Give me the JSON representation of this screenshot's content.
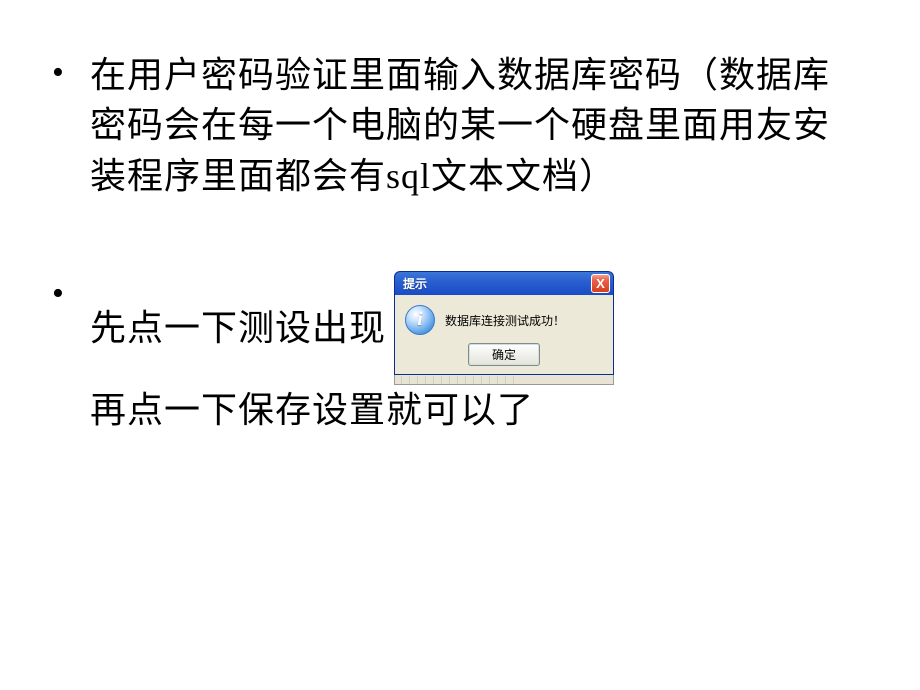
{
  "bullet1": "在用户密码验证里面输入数据库密码（数据库密码会在每一个电脑的某一个硬盘里面用友安装程序里面都会有sql文本文档）",
  "bullet2_part1": "先点一下测设出现",
  "bullet2_part2": "再点一下保存设置就可以了",
  "dialog": {
    "title": "提示",
    "close": "X",
    "info_glyph": "i",
    "message": "数据库连接测试成功！",
    "ok": "确定"
  }
}
